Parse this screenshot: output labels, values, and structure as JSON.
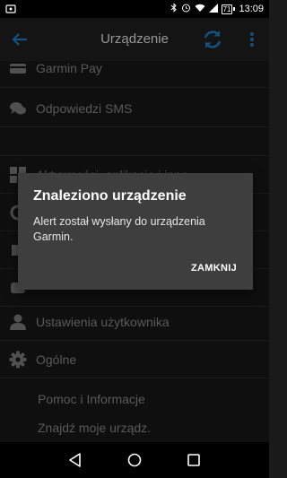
{
  "status_bar": {
    "battery": "71",
    "time": "13:09",
    "icons": [
      "notification-icon",
      "bluetooth-icon",
      "alarm-icon",
      "wifi-icon",
      "signal-icon",
      "battery-icon"
    ]
  },
  "app_bar": {
    "title": "Urządzenie",
    "back_icon": "arrow-left-icon",
    "sync_icon": "sync-icon",
    "menu_icon": "more-vert-icon"
  },
  "menu": {
    "items": [
      {
        "label": "Garmin Pay",
        "icon": "wallet-icon"
      },
      {
        "label": "Odpowiedzi SMS",
        "icon": "chat-icon"
      },
      {
        "label": "",
        "icon": ""
      },
      {
        "label": "Aktywności, aplikacje i inne",
        "icon": "grid-icon"
      },
      {
        "label": "Ustawienia użytkownika",
        "icon": "person-icon"
      },
      {
        "label": "Ogólne",
        "icon": "gear-icon"
      },
      {
        "label": "Pomoc i Informacje",
        "icon": ""
      },
      {
        "label": "Znajdź moje urządz.",
        "icon": ""
      }
    ]
  },
  "dialog": {
    "title": "Znaleziono urządzenie",
    "message": "Alert został wysłany do urządzenia Garmin.",
    "button": "ZAMKNIJ"
  },
  "colors": {
    "accent": "#1e8fd9",
    "background": "#1a1a1a",
    "appbar": "#242424",
    "dialog": "#3e3e3e"
  }
}
